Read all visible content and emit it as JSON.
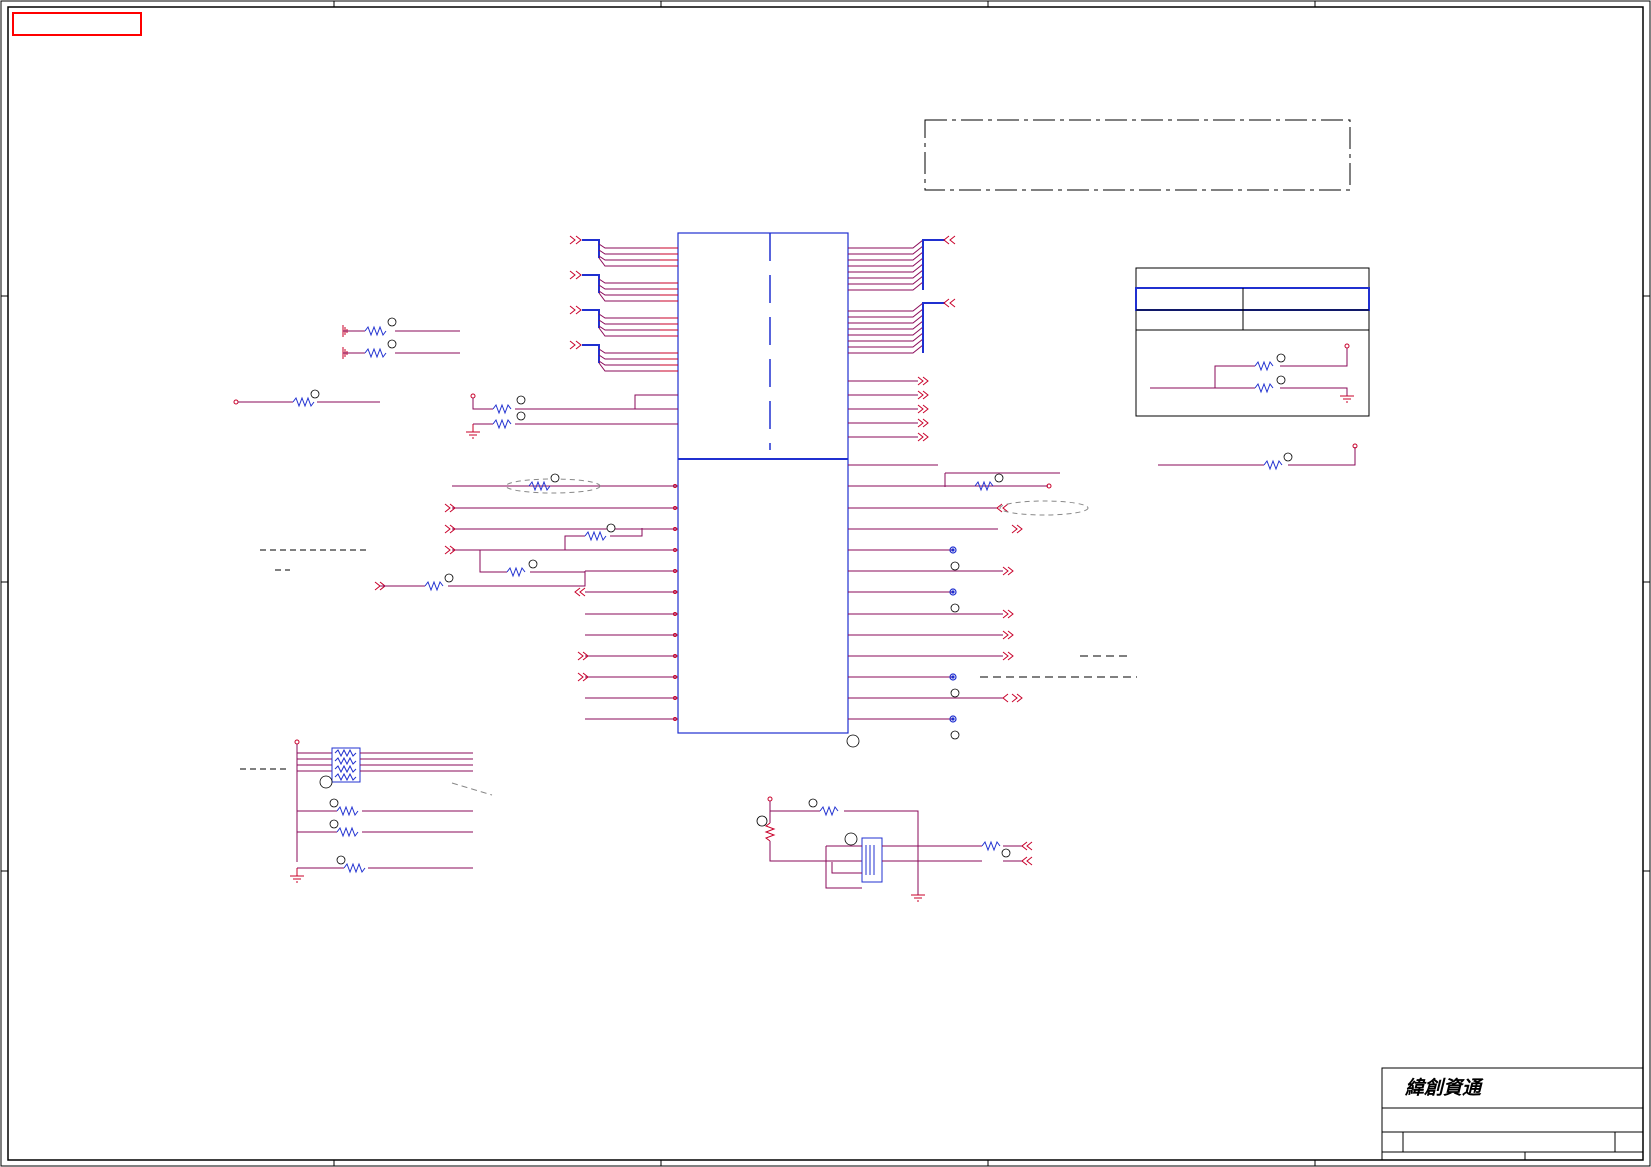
{
  "title_block": {
    "company": "緯創資通"
  },
  "colors": {
    "wire": "#c8002a",
    "net_trace": "#8a0a5a",
    "component": "#2030d0",
    "border": "#000000",
    "highlight_box": "#ff0000",
    "dashed_note": "#888888"
  },
  "icons": {
    "port_arrow": "double-chevron-icon",
    "ground": "ground-icon",
    "power_pin": "power-pin-icon",
    "resistor": "resistor-icon",
    "test_point": "test-point-icon",
    "resistor_array": "resistor-array-icon",
    "mosfet": "mosfet-icon"
  }
}
